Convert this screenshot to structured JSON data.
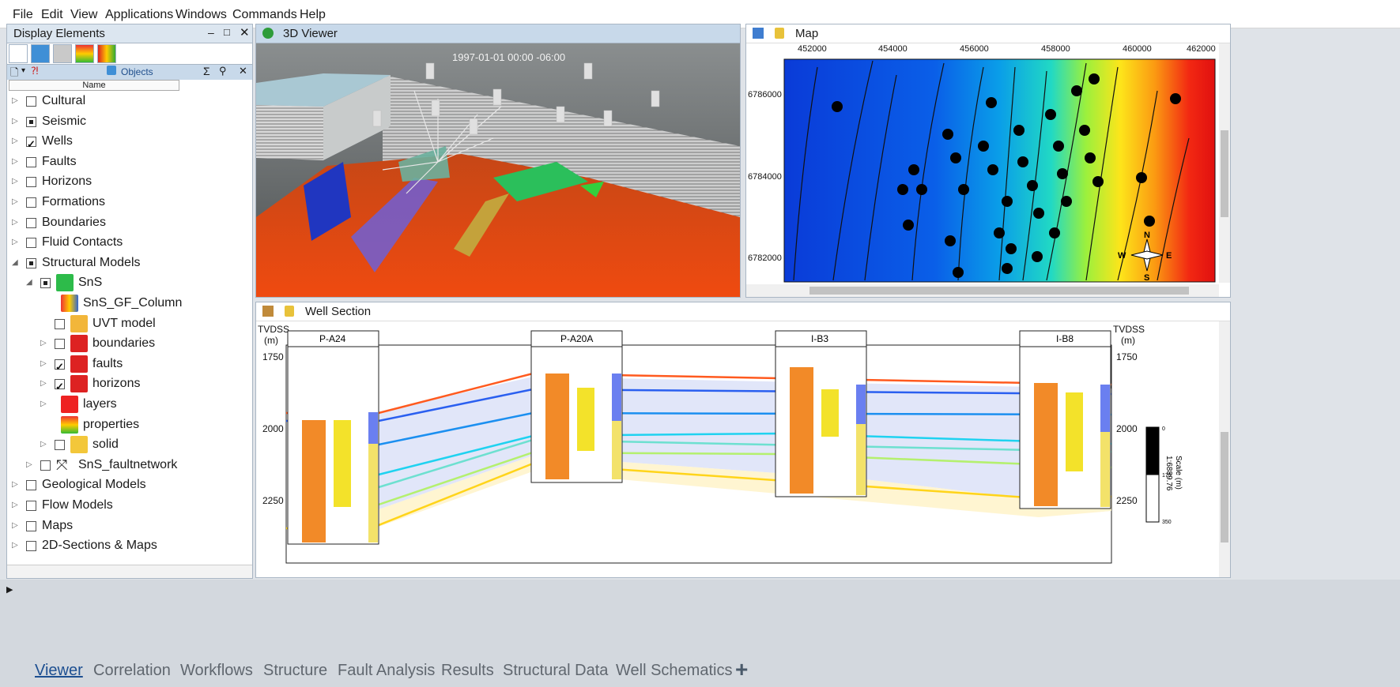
{
  "menu": [
    "File",
    "Edit",
    "View",
    "Applications",
    "Windows",
    "Commands",
    "Help"
  ],
  "display_elements": {
    "title": "Display Elements",
    "objects_tab": "Objects",
    "column_header": "Name",
    "tree": [
      {
        "label": "Cultural",
        "state": "off",
        "icon": "none"
      },
      {
        "label": "Seismic",
        "state": "partial",
        "icon": "none"
      },
      {
        "label": "Wells",
        "state": "on",
        "icon": "none"
      },
      {
        "label": "Faults",
        "state": "off",
        "icon": "none"
      },
      {
        "label": "Horizons",
        "state": "off",
        "icon": "none"
      },
      {
        "label": "Formations",
        "state": "off",
        "icon": "none"
      },
      {
        "label": "Boundaries",
        "state": "off",
        "icon": "none"
      },
      {
        "label": "Fluid Contacts",
        "state": "off",
        "icon": "none"
      },
      {
        "label": "Structural Models",
        "state": "partial",
        "icon": "none"
      },
      {
        "label": "SnS",
        "state": "partial",
        "icon": "green-cube-icon"
      },
      {
        "label": "SnS_GF_Column",
        "state": "none",
        "icon": "column-icon"
      },
      {
        "label": "UVT model",
        "state": "off",
        "icon": "uvt-icon"
      },
      {
        "label": "boundaries",
        "state": "off",
        "icon": "boundaries-icon"
      },
      {
        "label": "faults",
        "state": "on",
        "icon": "faults-icon"
      },
      {
        "label": "horizons",
        "state": "on",
        "icon": "horizons-icon"
      },
      {
        "label": "layers",
        "state": "none",
        "icon": "layers-icon"
      },
      {
        "label": "properties",
        "state": "none",
        "icon": "properties-icon"
      },
      {
        "label": "solid",
        "state": "off",
        "icon": "solid-icon"
      },
      {
        "label": "SnS_faultnetwork",
        "state": "off",
        "icon": "faultnetwork-icon"
      },
      {
        "label": "Geological Models",
        "state": "off",
        "icon": "none"
      },
      {
        "label": "Flow Models",
        "state": "off",
        "icon": "none"
      },
      {
        "label": "Maps",
        "state": "off",
        "icon": "none"
      },
      {
        "label": "2D-Sections & Maps",
        "state": "off",
        "icon": "none"
      }
    ]
  },
  "viewer3d": {
    "title": "3D Viewer",
    "timestamp": "1997-01-01   00:00 -06:00"
  },
  "map": {
    "title": "Map",
    "x_ticks": [
      "452000",
      "454000",
      "456000",
      "458000",
      "460000",
      "462000"
    ],
    "y_ticks": [
      "6786000",
      "6784000",
      "6782000"
    ],
    "compass": {
      "n": "N",
      "s": "S",
      "e": "E",
      "w": "W"
    }
  },
  "well_section": {
    "title": "Well Section",
    "depth_label": "TVDSS",
    "depth_unit": "(m)",
    "depth_ticks": [
      "1750",
      "2000",
      "2250"
    ],
    "wells": [
      "P-A24",
      "P-A20A",
      "I-B3",
      "I-B8"
    ],
    "scale_label": "Scale (m)",
    "scale_value": "1:6889.76",
    "scale_ticks": [
      "0",
      "175",
      "350"
    ]
  },
  "bottom_tabs": [
    "Viewer",
    "Correlation",
    "Workflows",
    "Structure",
    "Fault Analysis",
    "Results",
    "Structural Data",
    "Well Schematics"
  ],
  "add_tab": "+"
}
